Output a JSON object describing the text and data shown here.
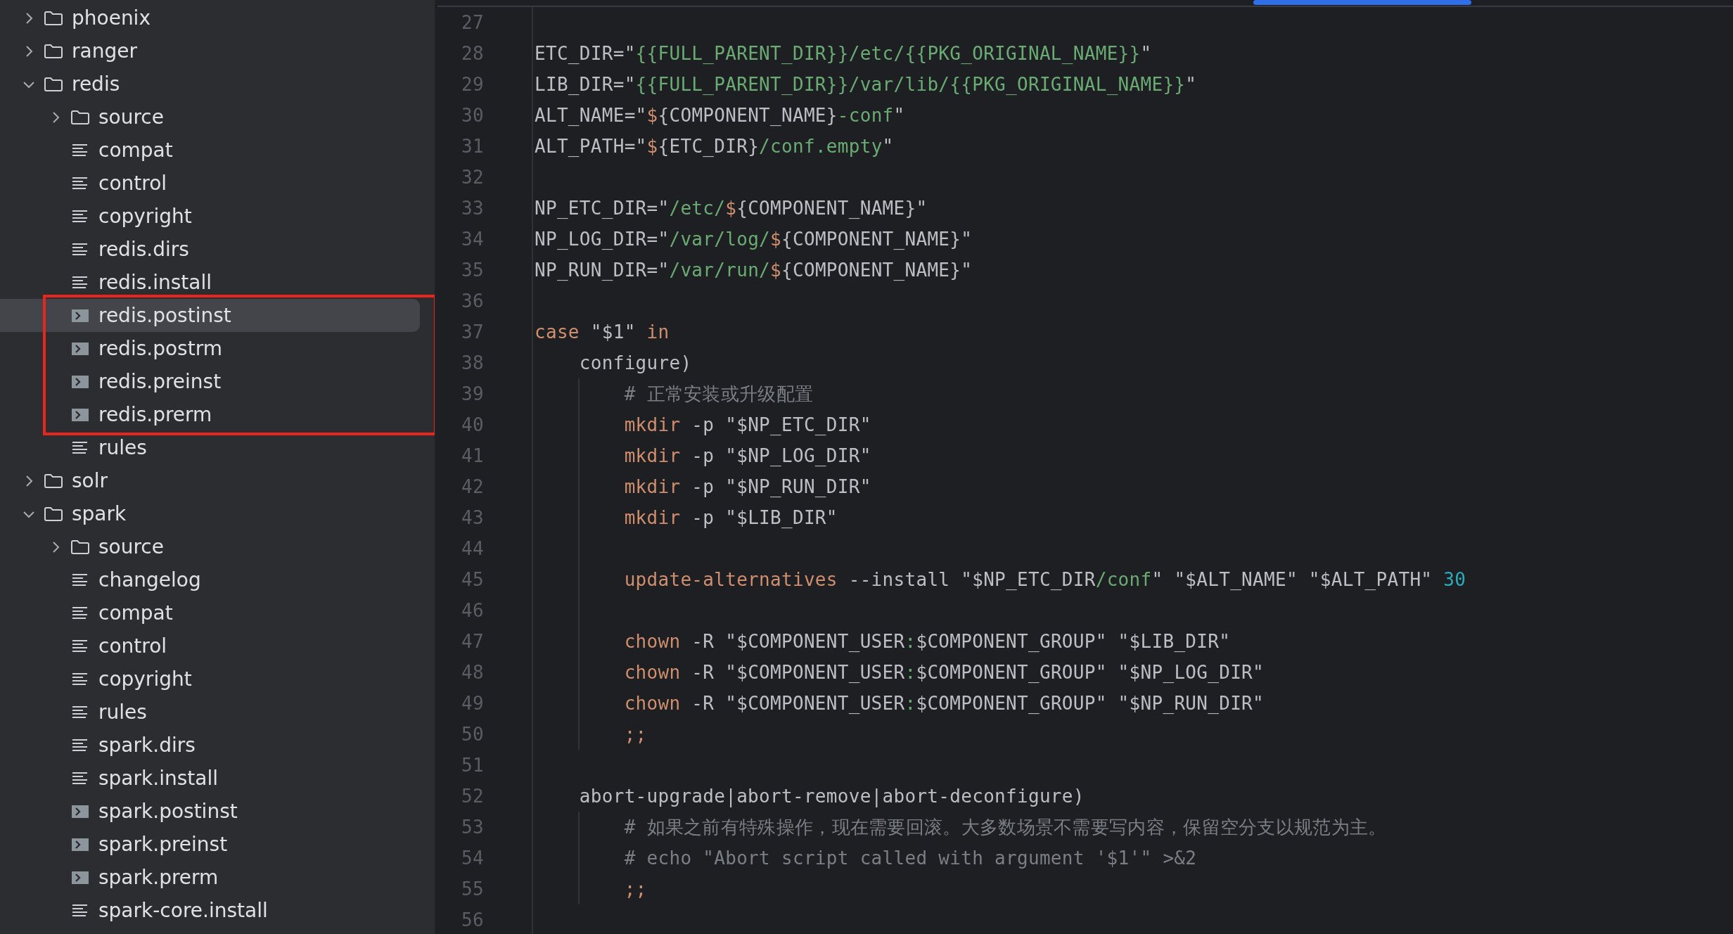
{
  "project_tree": [
    {
      "name": "phoenix",
      "kind": "folder",
      "expanded": false,
      "selected": false,
      "annotated": false
    },
    {
      "name": "ranger",
      "kind": "folder",
      "expanded": false,
      "selected": false,
      "annotated": false
    },
    {
      "name": "redis",
      "kind": "folder",
      "expanded": true,
      "selected": false,
      "annotated": false,
      "children": [
        {
          "name": "source",
          "kind": "folder",
          "expanded": false,
          "selected": false,
          "annotated": false
        },
        {
          "name": "compat",
          "kind": "text",
          "selected": false,
          "annotated": false
        },
        {
          "name": "control",
          "kind": "text",
          "selected": false,
          "annotated": false
        },
        {
          "name": "copyright",
          "kind": "text",
          "selected": false,
          "annotated": false
        },
        {
          "name": "redis.dirs",
          "kind": "text",
          "selected": false,
          "annotated": false
        },
        {
          "name": "redis.install",
          "kind": "text",
          "selected": false,
          "annotated": false
        },
        {
          "name": "redis.postinst",
          "kind": "script",
          "selected": true,
          "annotated": true
        },
        {
          "name": "redis.postrm",
          "kind": "script",
          "selected": false,
          "annotated": true
        },
        {
          "name": "redis.preinst",
          "kind": "script",
          "selected": false,
          "annotated": true
        },
        {
          "name": "redis.prerm",
          "kind": "script",
          "selected": false,
          "annotated": true
        },
        {
          "name": "rules",
          "kind": "text",
          "selected": false,
          "annotated": false
        }
      ]
    },
    {
      "name": "solr",
      "kind": "folder",
      "expanded": false,
      "selected": false,
      "annotated": false
    },
    {
      "name": "spark",
      "kind": "folder",
      "expanded": true,
      "selected": false,
      "annotated": false,
      "children": [
        {
          "name": "source",
          "kind": "folder",
          "expanded": false,
          "selected": false,
          "annotated": false
        },
        {
          "name": "changelog",
          "kind": "text",
          "selected": false,
          "annotated": false
        },
        {
          "name": "compat",
          "kind": "text",
          "selected": false,
          "annotated": false
        },
        {
          "name": "control",
          "kind": "text",
          "selected": false,
          "annotated": false
        },
        {
          "name": "copyright",
          "kind": "text",
          "selected": false,
          "annotated": false
        },
        {
          "name": "rules",
          "kind": "text",
          "selected": false,
          "annotated": false
        },
        {
          "name": "spark.dirs",
          "kind": "text",
          "selected": false,
          "annotated": false
        },
        {
          "name": "spark.install",
          "kind": "text",
          "selected": false,
          "annotated": false
        },
        {
          "name": "spark.postinst",
          "kind": "script",
          "selected": false,
          "annotated": false
        },
        {
          "name": "spark.preinst",
          "kind": "script",
          "selected": false,
          "annotated": false
        },
        {
          "name": "spark.prerm",
          "kind": "script",
          "selected": false,
          "annotated": false
        },
        {
          "name": "spark-core.install",
          "kind": "text",
          "selected": false,
          "annotated": false
        }
      ]
    }
  ],
  "editor": {
    "lines": [
      {
        "number": "27"
      },
      {
        "number": "28",
        "tokens": [
          {
            "text": "ETC_DIR=\"",
            "kind": "plain"
          },
          {
            "text": "{{FULL_PARENT_DIR}}/etc/{{PKG_ORIGINAL_NAME}}",
            "kind": "string"
          },
          {
            "text": "\"",
            "kind": "plain"
          }
        ]
      },
      {
        "number": "29",
        "tokens": [
          {
            "text": "LIB_DIR=\"",
            "kind": "plain"
          },
          {
            "text": "{{FULL_PARENT_DIR}}/var/lib/{{PKG_ORIGINAL_NAME}}",
            "kind": "string"
          },
          {
            "text": "\"",
            "kind": "plain"
          }
        ]
      },
      {
        "number": "30",
        "tokens": [
          {
            "text": "ALT_NAME=\"",
            "kind": "plain"
          },
          {
            "text": "$",
            "kind": "keyword"
          },
          {
            "text": "{COMPONENT_NAME}",
            "kind": "plain"
          },
          {
            "text": "-conf",
            "kind": "string"
          },
          {
            "text": "\"",
            "kind": "plain"
          }
        ]
      },
      {
        "number": "31",
        "tokens": [
          {
            "text": "ALT_PATH=\"",
            "kind": "plain"
          },
          {
            "text": "$",
            "kind": "keyword"
          },
          {
            "text": "{ETC_DIR}",
            "kind": "plain"
          },
          {
            "text": "/conf.empty",
            "kind": "string"
          },
          {
            "text": "\"",
            "kind": "plain"
          }
        ]
      },
      {
        "number": "32"
      },
      {
        "number": "33",
        "tokens": [
          {
            "text": "NP_ETC_DIR=\"",
            "kind": "plain"
          },
          {
            "text": "/etc/",
            "kind": "string"
          },
          {
            "text": "$",
            "kind": "keyword"
          },
          {
            "text": "{COMPONENT_NAME}\"",
            "kind": "plain"
          }
        ]
      },
      {
        "number": "34",
        "tokens": [
          {
            "text": "NP_LOG_DIR=\"",
            "kind": "plain"
          },
          {
            "text": "/var/log/",
            "kind": "string"
          },
          {
            "text": "$",
            "kind": "keyword"
          },
          {
            "text": "{COMPONENT_NAME}\"",
            "kind": "plain"
          }
        ]
      },
      {
        "number": "35",
        "tokens": [
          {
            "text": "NP_RUN_DIR=\"",
            "kind": "plain"
          },
          {
            "text": "/var/run/",
            "kind": "string"
          },
          {
            "text": "$",
            "kind": "keyword"
          },
          {
            "text": "{COMPONENT_NAME}\"",
            "kind": "plain"
          }
        ]
      },
      {
        "number": "36"
      },
      {
        "number": "37",
        "tokens": [
          {
            "text": "case",
            "kind": "keyword"
          },
          {
            "text": " \"$1\" ",
            "kind": "plain"
          },
          {
            "text": "in",
            "kind": "keyword"
          }
        ]
      },
      {
        "number": "38",
        "tokens": [
          {
            "text": "    configure)",
            "kind": "plain"
          }
        ]
      },
      {
        "number": "39",
        "tokens": [
          {
            "text": "        # 正常安装或升级配置",
            "kind": "comment"
          }
        ]
      },
      {
        "number": "40",
        "tokens": [
          {
            "text": "        mkdir",
            "kind": "keyword"
          },
          {
            "text": " -p \"$NP_ETC_DIR\"",
            "kind": "plain"
          }
        ]
      },
      {
        "number": "41",
        "tokens": [
          {
            "text": "        mkdir",
            "kind": "keyword"
          },
          {
            "text": " -p \"$NP_LOG_DIR\"",
            "kind": "plain"
          }
        ]
      },
      {
        "number": "42",
        "tokens": [
          {
            "text": "        mkdir",
            "kind": "keyword"
          },
          {
            "text": " -p \"$NP_RUN_DIR\"",
            "kind": "plain"
          }
        ]
      },
      {
        "number": "43",
        "tokens": [
          {
            "text": "        mkdir",
            "kind": "keyword"
          },
          {
            "text": " -p \"$LIB_DIR\"",
            "kind": "plain"
          }
        ]
      },
      {
        "number": "44"
      },
      {
        "number": "45",
        "tokens": [
          {
            "text": "        update-alternatives",
            "kind": "keyword"
          },
          {
            "text": " --install \"$NP_ETC_DIR",
            "kind": "plain"
          },
          {
            "text": "/conf",
            "kind": "string"
          },
          {
            "text": "\" \"$ALT_NAME\" \"$ALT_PATH\" ",
            "kind": "plain"
          },
          {
            "text": "30",
            "kind": "number"
          }
        ]
      },
      {
        "number": "46"
      },
      {
        "number": "47",
        "tokens": [
          {
            "text": "        chown",
            "kind": "keyword"
          },
          {
            "text": " -R \"$COMPONENT_USER",
            "kind": "plain"
          },
          {
            "text": ":",
            "kind": "string"
          },
          {
            "text": "$COMPONENT_GROUP\" \"$LIB_DIR\"",
            "kind": "plain"
          }
        ]
      },
      {
        "number": "48",
        "tokens": [
          {
            "text": "        chown",
            "kind": "keyword"
          },
          {
            "text": " -R \"$COMPONENT_USER",
            "kind": "plain"
          },
          {
            "text": ":",
            "kind": "string"
          },
          {
            "text": "$COMPONENT_GROUP\" \"$NP_LOG_DIR\"",
            "kind": "plain"
          }
        ]
      },
      {
        "number": "49",
        "tokens": [
          {
            "text": "        chown",
            "kind": "keyword"
          },
          {
            "text": " -R \"$COMPONENT_USER",
            "kind": "plain"
          },
          {
            "text": ":",
            "kind": "string"
          },
          {
            "text": "$COMPONENT_GROUP\" \"$NP_RUN_DIR\"",
            "kind": "plain"
          }
        ]
      },
      {
        "number": "50",
        "tokens": [
          {
            "text": "        ;;",
            "kind": "keyword"
          }
        ]
      },
      {
        "number": "51"
      },
      {
        "number": "52",
        "tokens": [
          {
            "text": "    abort-upgrade|abort-remove|abort-deconfigure)",
            "kind": "plain"
          }
        ]
      },
      {
        "number": "53",
        "tokens": [
          {
            "text": "        # 如果之前有特殊操作，现在需要回滚。大多数场景不需要写内容，保留空分支以规范为主。",
            "kind": "comment"
          }
        ]
      },
      {
        "number": "54",
        "tokens": [
          {
            "text": "        # echo \"Abort script called with argument '$1'\" >&2",
            "kind": "comment"
          }
        ]
      },
      {
        "number": "55",
        "tokens": [
          {
            "text": "        ;;",
            "kind": "keyword"
          }
        ]
      },
      {
        "number": "56"
      }
    ]
  }
}
